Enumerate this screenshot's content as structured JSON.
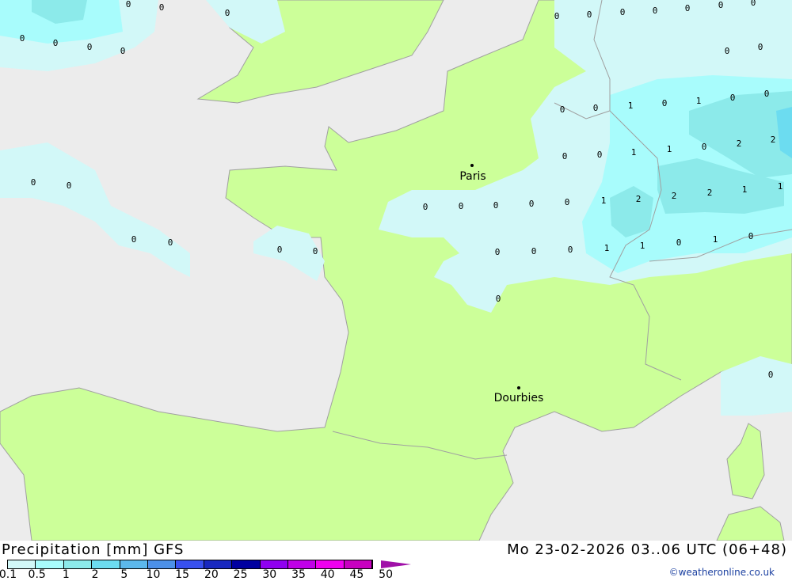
{
  "title": "Precipitation [mm] GFS",
  "valid_time": "Mo 23-02-2026 03..06 UTC (06+48)",
  "credit": "©weatheronline.co.uk",
  "colors": {
    "sea": "#ececec",
    "land": "#ccff99",
    "border": "#a0a0a0"
  },
  "legend": {
    "ticks": [
      "0.1",
      "0.5",
      "1",
      "2",
      "5",
      "10",
      "15",
      "20",
      "25",
      "30",
      "35",
      "40",
      "45",
      "50"
    ],
    "colors": [
      "#d2f8f8",
      "#a8fcfc",
      "#8ceaea",
      "#6cdcf0",
      "#5cb8ec",
      "#4c90e8",
      "#3850f0",
      "#1828c0",
      "#0000a0",
      "#9000f0",
      "#c000e8",
      "#f000f0",
      "#c800c0"
    ]
  },
  "cities": [
    {
      "name": "Paris"
    },
    {
      "name": "Dourbies"
    }
  ],
  "value_labels": [
    "0",
    "0",
    "0",
    "0",
    "0",
    "0",
    "0",
    "0",
    "0",
    "0",
    "0",
    "0",
    "0",
    "0",
    "0",
    "0",
    "0",
    "0",
    "1",
    "0",
    "1",
    "0",
    "0",
    "0",
    "0",
    "1",
    "1",
    "0",
    "2",
    "2",
    "0",
    "0",
    "0",
    "0",
    "0",
    "0",
    "0",
    "0",
    "0",
    "0",
    "0",
    "1",
    "2",
    "2",
    "2",
    "1",
    "1",
    "0",
    "0",
    "0",
    "1",
    "1",
    "0",
    "1",
    "0",
    "0",
    "0"
  ]
}
